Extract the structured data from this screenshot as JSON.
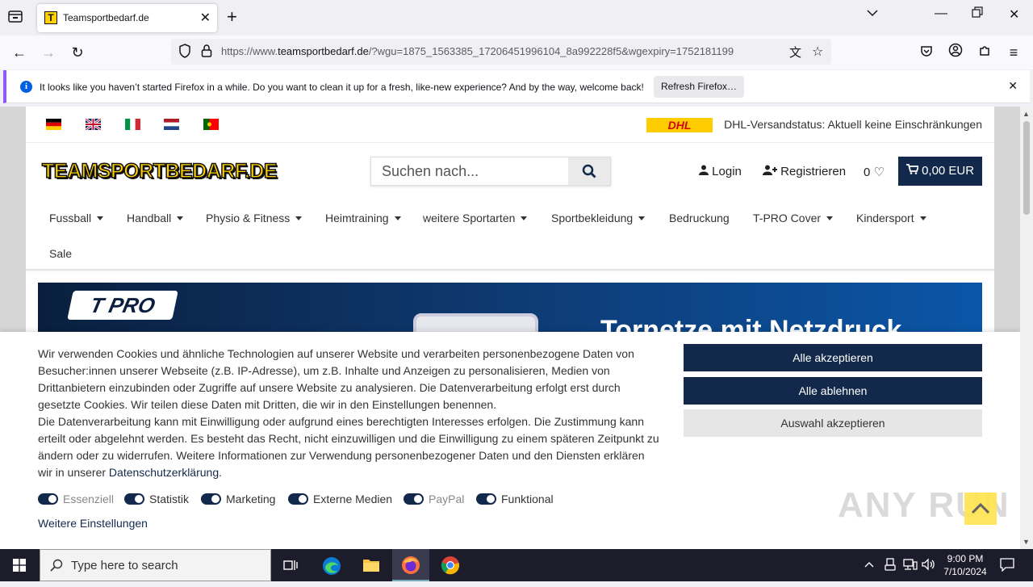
{
  "browser": {
    "tab_title": "Teamsportbedarf.de",
    "tab_favicon_letter": "T",
    "url_prefix": "https://www.",
    "url_domain": "teamsportbedarf.de",
    "url_rest": "/?wgu=1875_1563385_17206451996104_8a992228f5&wgexpiry=1752181199",
    "notification": {
      "text": "It looks like you haven’t started Firefox in a while. Do you want to clean it up for a fresh, like-new experience? And by the way, welcome back!",
      "button": "Refresh Firefox…"
    }
  },
  "site": {
    "dhl_logo": "DHL",
    "dhl_status": "DHL-Versandstatus: Aktuell keine Einschränkungen",
    "logo": "TEAMSPORTBEDARF.DE",
    "search_placeholder": "Suchen nach...",
    "login": "Login",
    "register": "Registrieren",
    "wishlist_count": "0",
    "cart_total": "0,00 EUR",
    "menu": [
      {
        "label": "Fussball",
        "dropdown": true
      },
      {
        "label": "Handball",
        "dropdown": true
      },
      {
        "label": "Physio & Fitness",
        "dropdown": true
      },
      {
        "label": "Heimtraining",
        "dropdown": true
      },
      {
        "label": "weitere Sportarten",
        "dropdown": true
      },
      {
        "label": "Sportbekleidung",
        "dropdown": true
      },
      {
        "label": "Bedruckung",
        "dropdown": false
      },
      {
        "label": "T-PRO Cover",
        "dropdown": true
      },
      {
        "label": "Kindersport",
        "dropdown": true
      },
      {
        "label": "Sale",
        "dropdown": false
      }
    ],
    "banner_brand": "T PRO",
    "banner_text": "Tornetze mit Netzdruck"
  },
  "cookie": {
    "paragraph1": "Wir verwenden Cookies und ähnliche Technologien auf unserer Website und verarbeiten personenbezogene Daten von Besucher:innen unserer Webseite (z.B. IP-Adresse), um z.B. Inhalte und Anzeigen zu personalisieren, Medien von Drittanbietern einzubinden oder Zugriffe auf unsere Website zu analysieren. Die Datenverarbeitung erfolgt erst durch gesetzte Cookies. Wir teilen diese Daten mit Dritten, die wir in den Einstellungen benennen.",
    "paragraph2": "Die Datenverarbeitung kann mit Einwilligung oder aufgrund eines berechtigten Interesses erfolgen. Die Zustimmung kann erteilt oder abgelehnt werden. Es besteht das Recht, nicht einzuwilligen und die Einwilligung zu einem späteren Zeitpunkt zu ändern oder zu widerrufen. Weitere Informationen zur Verwendung personenbezogener Daten und den Diensten erklären wir in unserer ",
    "privacy_link": "Datenschutzerklärung",
    "paragraph2_end": ".",
    "accept_all": "Alle akzeptieren",
    "reject_all": "Alle ablehnen",
    "accept_selection": "Auswahl akzeptieren",
    "toggles": [
      {
        "label": "Essenziell",
        "disabled": true
      },
      {
        "label": "Statistik",
        "disabled": false
      },
      {
        "label": "Marketing",
        "disabled": false
      },
      {
        "label": "Externe Medien",
        "disabled": false
      },
      {
        "label": "PayPal",
        "disabled": true
      },
      {
        "label": "Funktional",
        "disabled": false
      }
    ],
    "more_settings": "Weitere Einstellungen"
  },
  "watermark": "ANY RUN",
  "taskbar": {
    "search_placeholder": "Type here to search",
    "time": "9:00 PM",
    "date": "7/10/2024"
  },
  "colors": {
    "brand_navy": "#13294b",
    "brand_yellow": "#ffd200",
    "firefox_accent": "#9059ff"
  }
}
